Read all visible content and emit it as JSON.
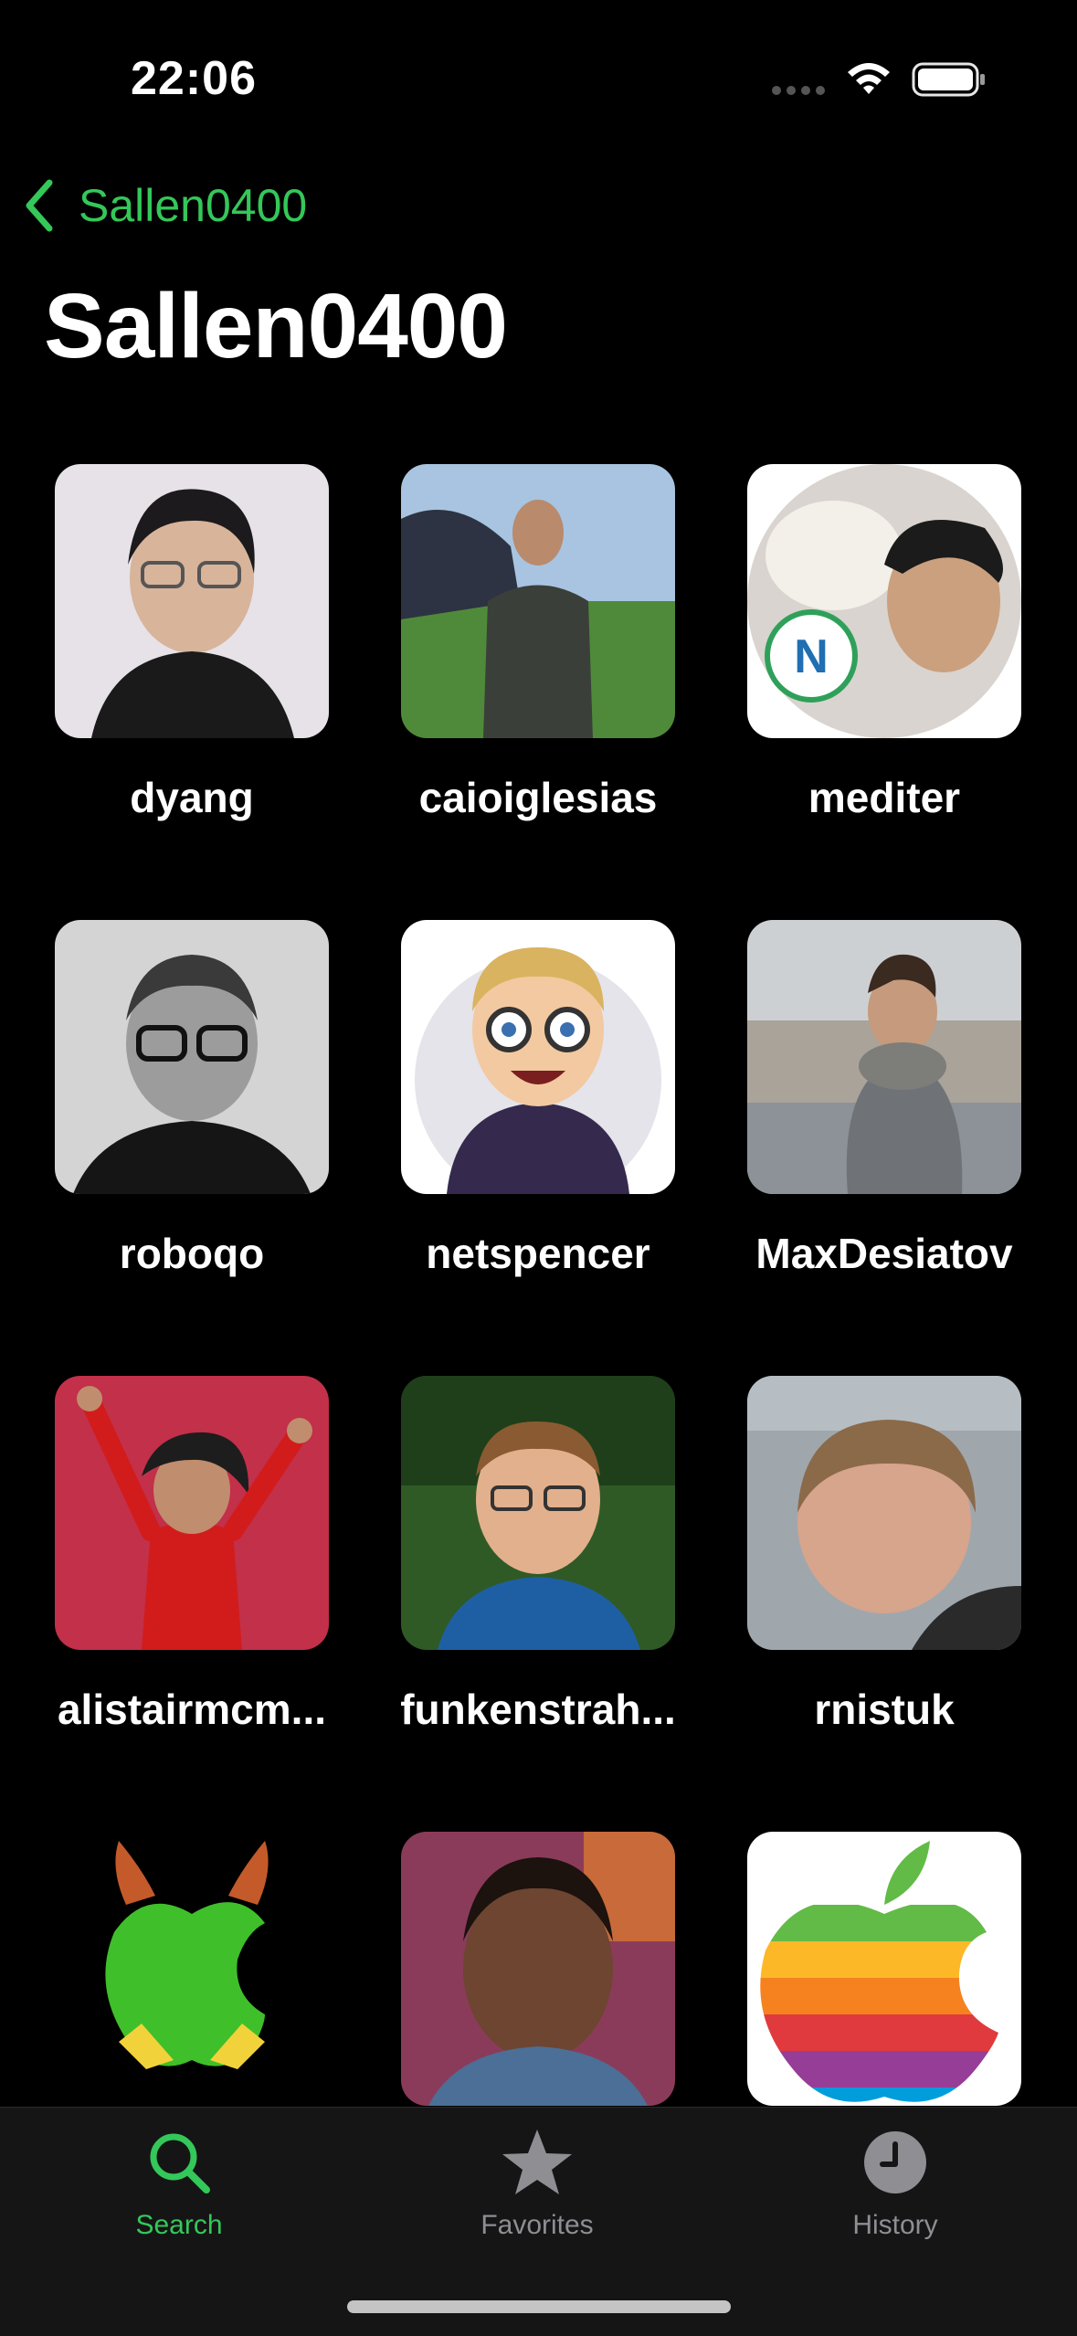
{
  "status_bar": {
    "time": "22:06"
  },
  "nav": {
    "back_label": "Sallen0400",
    "title": "Sallen0400"
  },
  "users": [
    {
      "login": "dyang"
    },
    {
      "login": "caioiglesias"
    },
    {
      "login": "mediter"
    },
    {
      "login": "roboqo"
    },
    {
      "login": "netspencer"
    },
    {
      "login": "MaxDesiatov"
    },
    {
      "login": "alistairmcm..."
    },
    {
      "login": "funkenstrah..."
    },
    {
      "login": "rnistuk"
    },
    {
      "login": ""
    },
    {
      "login": ""
    },
    {
      "login": ""
    }
  ],
  "tabs": [
    {
      "label": "Search",
      "icon": "magnifier-icon",
      "active": true
    },
    {
      "label": "Favorites",
      "icon": "star-icon",
      "active": false
    },
    {
      "label": "History",
      "icon": "clock-icon",
      "active": false
    }
  ],
  "colors": {
    "accent": "#34c759",
    "background": "#000000",
    "tab_bar": "#151516",
    "inactive": "#8e8e93"
  }
}
